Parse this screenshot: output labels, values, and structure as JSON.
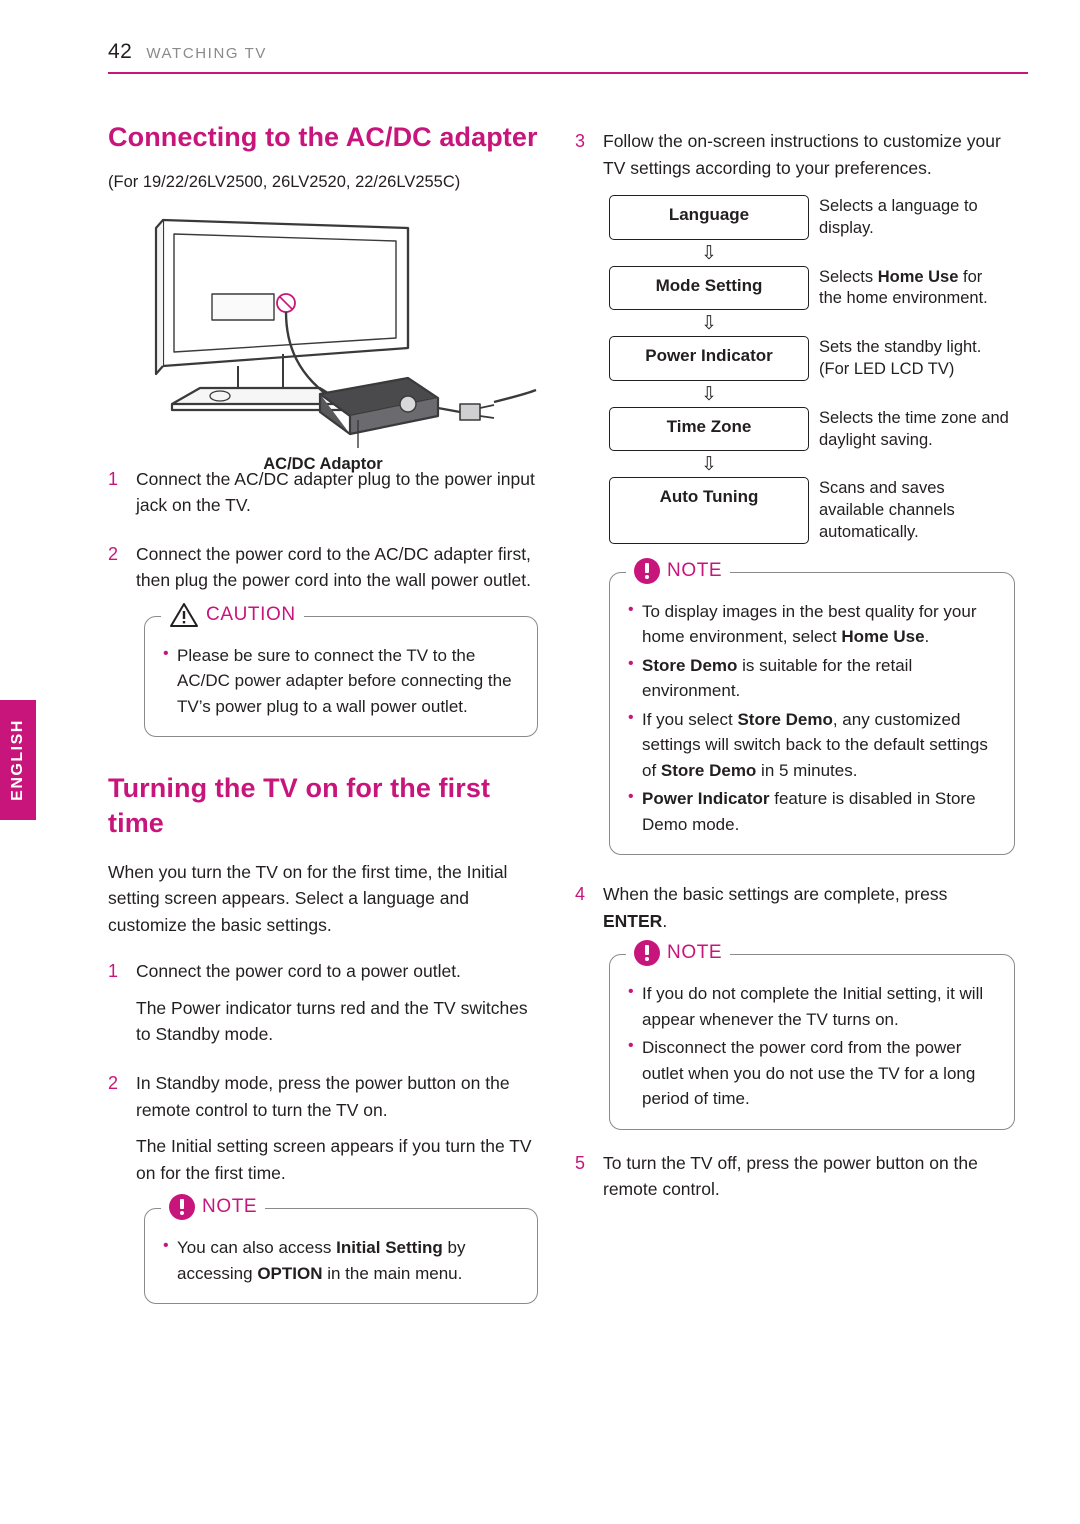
{
  "header": {
    "page_number": "42",
    "section": "WATCHING TV",
    "accent": "#c8157c"
  },
  "side_tab": {
    "label": "ENGLISH"
  },
  "left": {
    "heading1": "Connecting to the AC/DC adapter",
    "models": "(For 19/22/26LV2500, 26LV2520, 22/26LV255C)",
    "figure_caption": "AC/DC Adaptor",
    "steps": [
      {
        "num": "1",
        "lines": [
          "Connect the AC/DC adapter plug to the power input jack on the TV."
        ]
      },
      {
        "num": "2",
        "lines": [
          "Connect the power cord to the AC/DC adapter first, then plug the power cord into the wall power outlet."
        ]
      }
    ],
    "caution": {
      "label": "CAUTION",
      "bullets": [
        "Please be sure to connect the TV to the AC/DC power adapter before connecting the TV’s power plug to a wall power outlet."
      ]
    },
    "heading2": "Turning the TV on for the first time",
    "intro": "When you turn the TV on for the first time, the Initial setting screen appears. Select a language and customize the basic settings.",
    "steps2": [
      {
        "num": "1",
        "lines": [
          "Connect the power cord to a power outlet.",
          "The Power indicator turns red and the TV switches to Standby mode."
        ]
      },
      {
        "num": "2",
        "lines": [
          "In Standby mode, press the power button on the remote control to turn the TV on.",
          "The Initial setting screen appears if you turn the TV on for the first time."
        ]
      }
    ],
    "note": {
      "label": "NOTE",
      "bullet_prefix": "You can also access ",
      "bullet_bold1": "Initial Setting",
      "bullet_mid": " by accessing ",
      "bullet_bold2": "OPTION",
      "bullet_suffix": " in the main menu."
    }
  },
  "right": {
    "step3": {
      "num": "3",
      "text": "Follow the on-screen instructions to customize your TV settings according to your preferences."
    },
    "flow": [
      {
        "box": "Language",
        "desc": "Selects a language to display.",
        "arrow": "⇩"
      },
      {
        "box": "Mode Setting",
        "desc_pre": "Selects ",
        "desc_bold": "Home Use",
        "desc_post": " for the home environment.",
        "arrow": "⇩"
      },
      {
        "box": "Power Indicator",
        "desc": "Sets the standby light. (For LED LCD TV)",
        "arrow": "⇩"
      },
      {
        "box": "Time Zone",
        "desc": "Selects the time zone and daylight saving.",
        "arrow": "⇩"
      },
      {
        "box": "Auto Tuning",
        "desc": "Scans and saves available channels automatically.",
        "arrow": ""
      }
    ],
    "note1": {
      "label": "NOTE",
      "bullets": [
        {
          "parts": [
            {
              "t": "To display images in the best quality for your home environment, select "
            },
            {
              "t": "Home Use",
              "b": true
            },
            {
              "t": "."
            }
          ]
        },
        {
          "parts": [
            {
              "t": "Store Demo",
              "b": true
            },
            {
              "t": " is suitable for the retail environment."
            }
          ]
        },
        {
          "parts": [
            {
              "t": "If you select "
            },
            {
              "t": "Store Demo",
              "b": true
            },
            {
              "t": ", any customized settings will switch back to the default settings of "
            },
            {
              "t": "Store Demo",
              "b": true
            },
            {
              "t": " in 5 minutes."
            }
          ]
        },
        {
          "parts": [
            {
              "t": "Power Indicator",
              "b": true
            },
            {
              "t": " feature is disabled in Store Demo mode."
            }
          ]
        }
      ]
    },
    "step4": {
      "num": "4",
      "pre": "When the basic settings are complete, press ",
      "bold": "ENTER",
      "post": "."
    },
    "note2": {
      "label": "NOTE",
      "bullets": [
        {
          "parts": [
            {
              "t": "If you do not complete the Initial setting, it will appear whenever the TV turns on."
            }
          ]
        },
        {
          "parts": [
            {
              "t": "Disconnect the power cord from the power outlet when you do not use the TV for a long period of time."
            }
          ]
        }
      ]
    },
    "step5": {
      "num": "5",
      "text": "To turn the TV off, press the power button on the remote control."
    }
  }
}
